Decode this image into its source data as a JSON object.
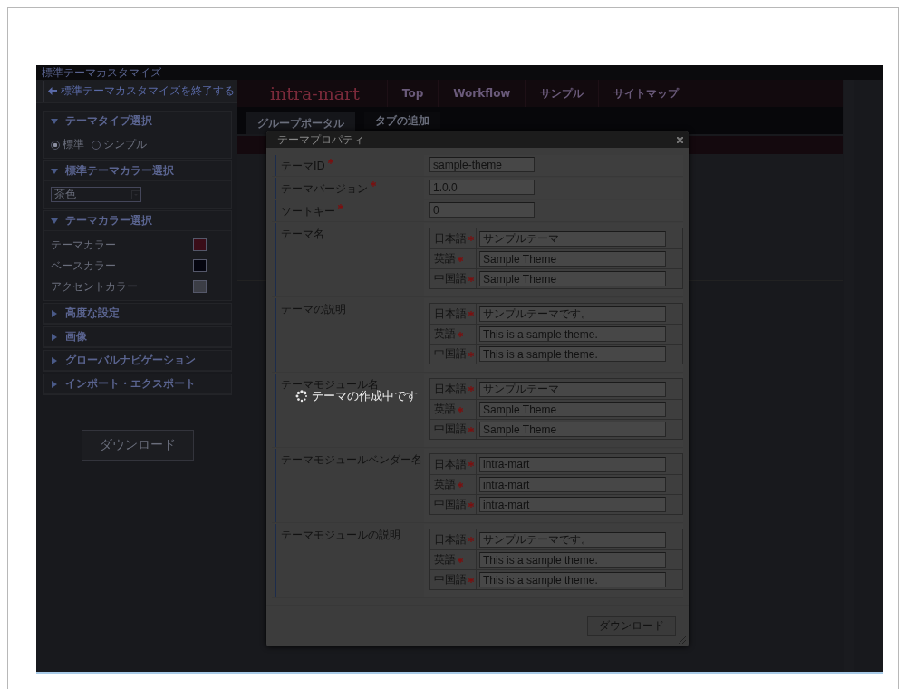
{
  "window_title": "標準テーマカスタマイズ",
  "toolbar": {
    "exit_button": "標準テーマカスタマイズを終了する"
  },
  "sidebar": {
    "sections": [
      {
        "title": "テーマタイプ選択",
        "expanded": true,
        "kind": "radio",
        "options": [
          {
            "label": "標準",
            "selected": true
          },
          {
            "label": "シンプル",
            "selected": false
          }
        ]
      },
      {
        "title": "標準テーマカラー選択",
        "expanded": true,
        "kind": "select",
        "value": "茶色"
      },
      {
        "title": "テーマカラー選択",
        "expanded": true,
        "kind": "colors",
        "colors": [
          {
            "label": "テーマカラー",
            "color": "#3a0d18"
          },
          {
            "label": "ベースカラー",
            "color": "#05050f"
          },
          {
            "label": "アクセントカラー",
            "color": "#3c3e46"
          }
        ]
      },
      {
        "title": "高度な設定",
        "expanded": false,
        "kind": "plain"
      },
      {
        "title": "画像",
        "expanded": false,
        "kind": "plain"
      },
      {
        "title": "グローバルナビゲーション",
        "expanded": false,
        "kind": "plain"
      },
      {
        "title": "インポート・エクスポート",
        "expanded": false,
        "kind": "plain"
      }
    ],
    "download_button": "ダウンロード"
  },
  "portal": {
    "logo": "intra-mart",
    "nav": [
      "Top",
      "Workflow",
      "サンプル",
      "サイトマップ"
    ],
    "tabs": [
      {
        "label": "グループポータル",
        "selected": true
      },
      {
        "label": "タブの追加",
        "selected": false
      }
    ]
  },
  "dialog": {
    "title": "テーマプロパティ",
    "fields": [
      {
        "kind": "single",
        "label": "テーマID",
        "required": true,
        "value": "sample-theme"
      },
      {
        "kind": "single",
        "label": "テーマバージョン",
        "required": true,
        "value": "1.0.0"
      },
      {
        "kind": "single",
        "label": "ソートキー",
        "required": true,
        "value": "0"
      },
      {
        "kind": "multi",
        "label": "テーマ名",
        "entries": [
          {
            "lang": "日本語",
            "required": true,
            "value": "サンプルテーマ"
          },
          {
            "lang": "英語",
            "required": true,
            "value": "Sample Theme"
          },
          {
            "lang": "中国語",
            "required": true,
            "value": "Sample Theme"
          }
        ]
      },
      {
        "kind": "multi",
        "label": "テーマの説明",
        "entries": [
          {
            "lang": "日本語",
            "required": true,
            "value": "サンプルテーマです。"
          },
          {
            "lang": "英語",
            "required": true,
            "value": "This is a sample theme."
          },
          {
            "lang": "中国語",
            "required": true,
            "value": "This is a sample theme."
          }
        ]
      },
      {
        "kind": "multi",
        "label": "テーマモジュール名",
        "entries": [
          {
            "lang": "日本語",
            "required": true,
            "value": "サンプルテーマ"
          },
          {
            "lang": "英語",
            "required": true,
            "value": "Sample Theme"
          },
          {
            "lang": "中国語",
            "required": true,
            "value": "Sample Theme"
          }
        ]
      },
      {
        "kind": "multi",
        "label": "テーマモジュールベンダー名",
        "entries": [
          {
            "lang": "日本語",
            "required": true,
            "value": "intra-mart"
          },
          {
            "lang": "英語",
            "required": true,
            "value": "intra-mart"
          },
          {
            "lang": "中国語",
            "required": true,
            "value": "intra-mart"
          }
        ]
      },
      {
        "kind": "multi",
        "label": "テーマモジュールの説明",
        "entries": [
          {
            "lang": "日本語",
            "required": true,
            "value": "サンプルテーマです。"
          },
          {
            "lang": "英語",
            "required": true,
            "value": "This is a sample theme."
          },
          {
            "lang": "中国語",
            "required": true,
            "value": "This is a sample theme."
          }
        ]
      }
    ],
    "footer_button": "ダウンロード"
  },
  "loading": {
    "message": "テーマの作成中です"
  }
}
